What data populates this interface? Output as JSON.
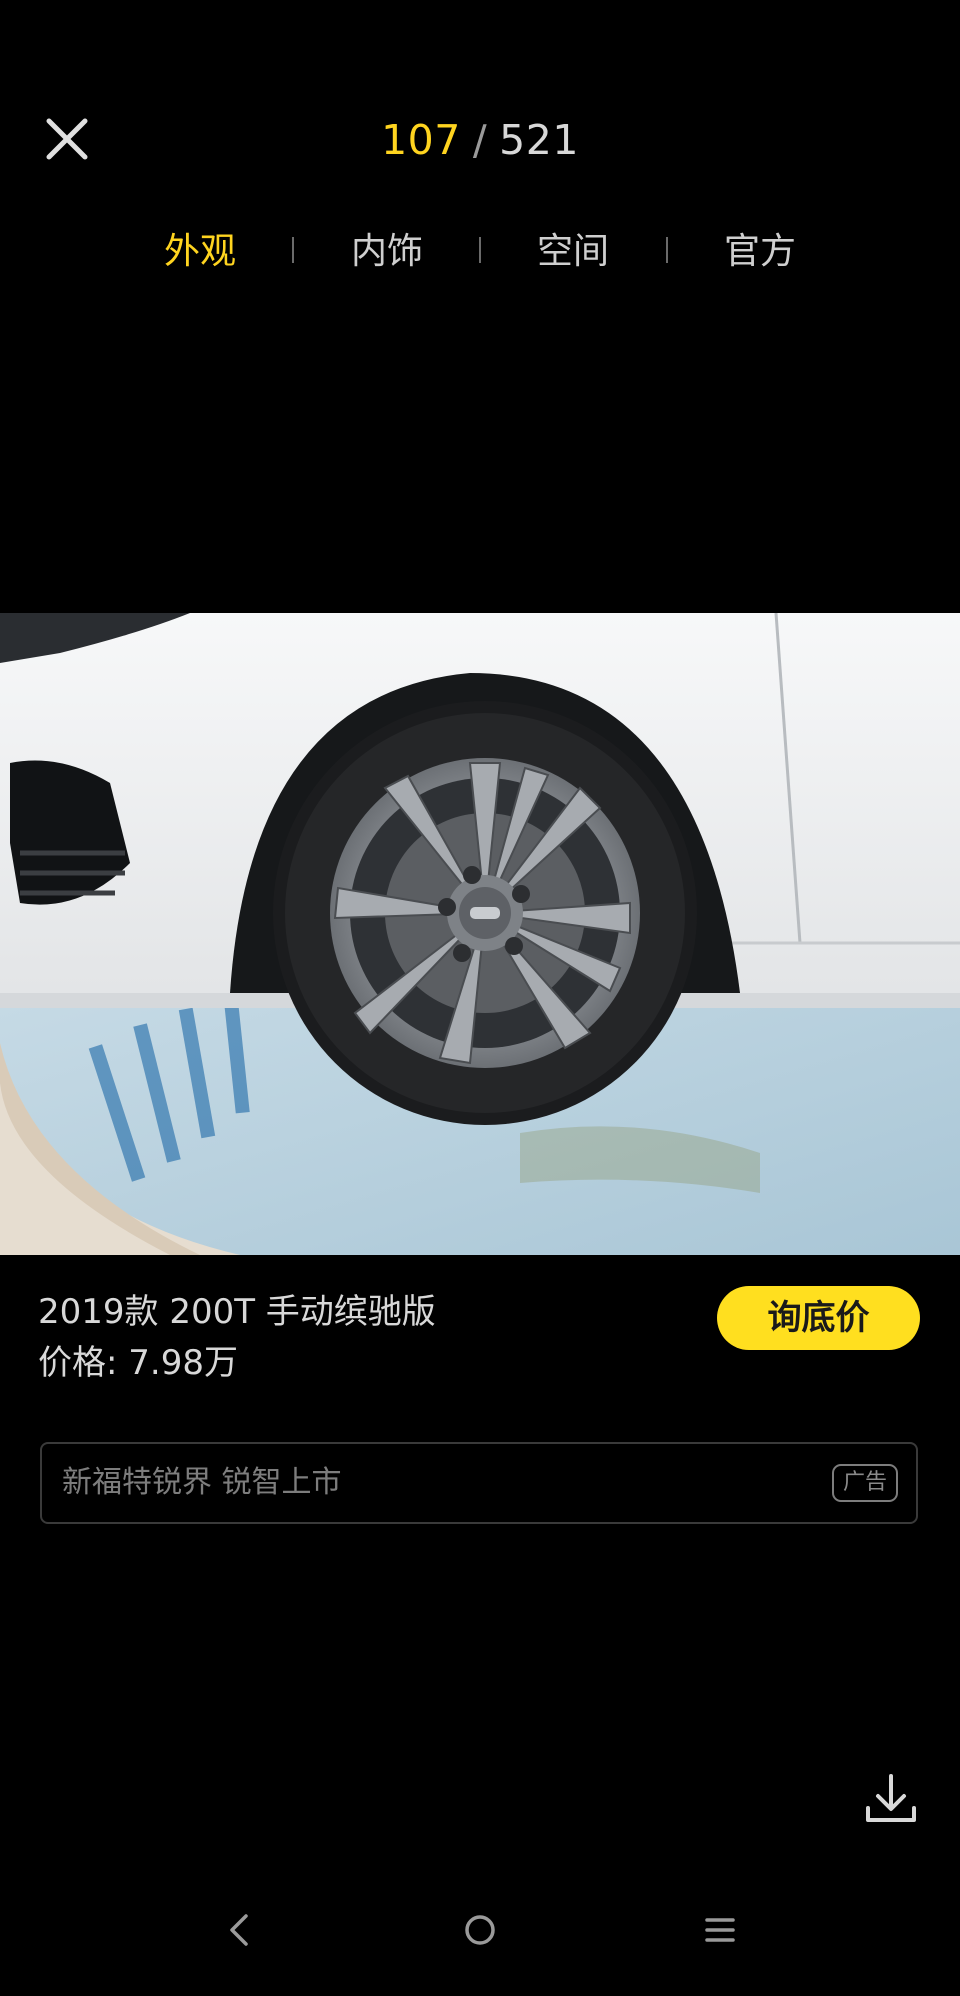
{
  "header": {
    "close_icon": "close-icon",
    "counter": {
      "current": "107",
      "separator": "/",
      "total": "521"
    },
    "tabs": [
      {
        "label": "外观",
        "active": true
      },
      {
        "label": "内饰",
        "active": false
      },
      {
        "label": "空间",
        "active": false
      },
      {
        "label": "官方",
        "active": false
      }
    ]
  },
  "photo": {
    "subject": "car-wheel-photo"
  },
  "info": {
    "model_title": "2019款 200T 手动缤驰版",
    "price": "价格: 7.98万",
    "inquiry_button": "询底价"
  },
  "ad": {
    "text": "新福特锐界 锐智上市",
    "badge": "广告"
  },
  "actions": {
    "download_icon": "download-icon"
  },
  "navbar": {
    "back_icon": "back-icon",
    "home_icon": "home-icon",
    "menu_icon": "menu-icon"
  },
  "colors": {
    "accent": "#ffd41f",
    "button_bg": "#ffdf1f",
    "background": "#000000"
  }
}
